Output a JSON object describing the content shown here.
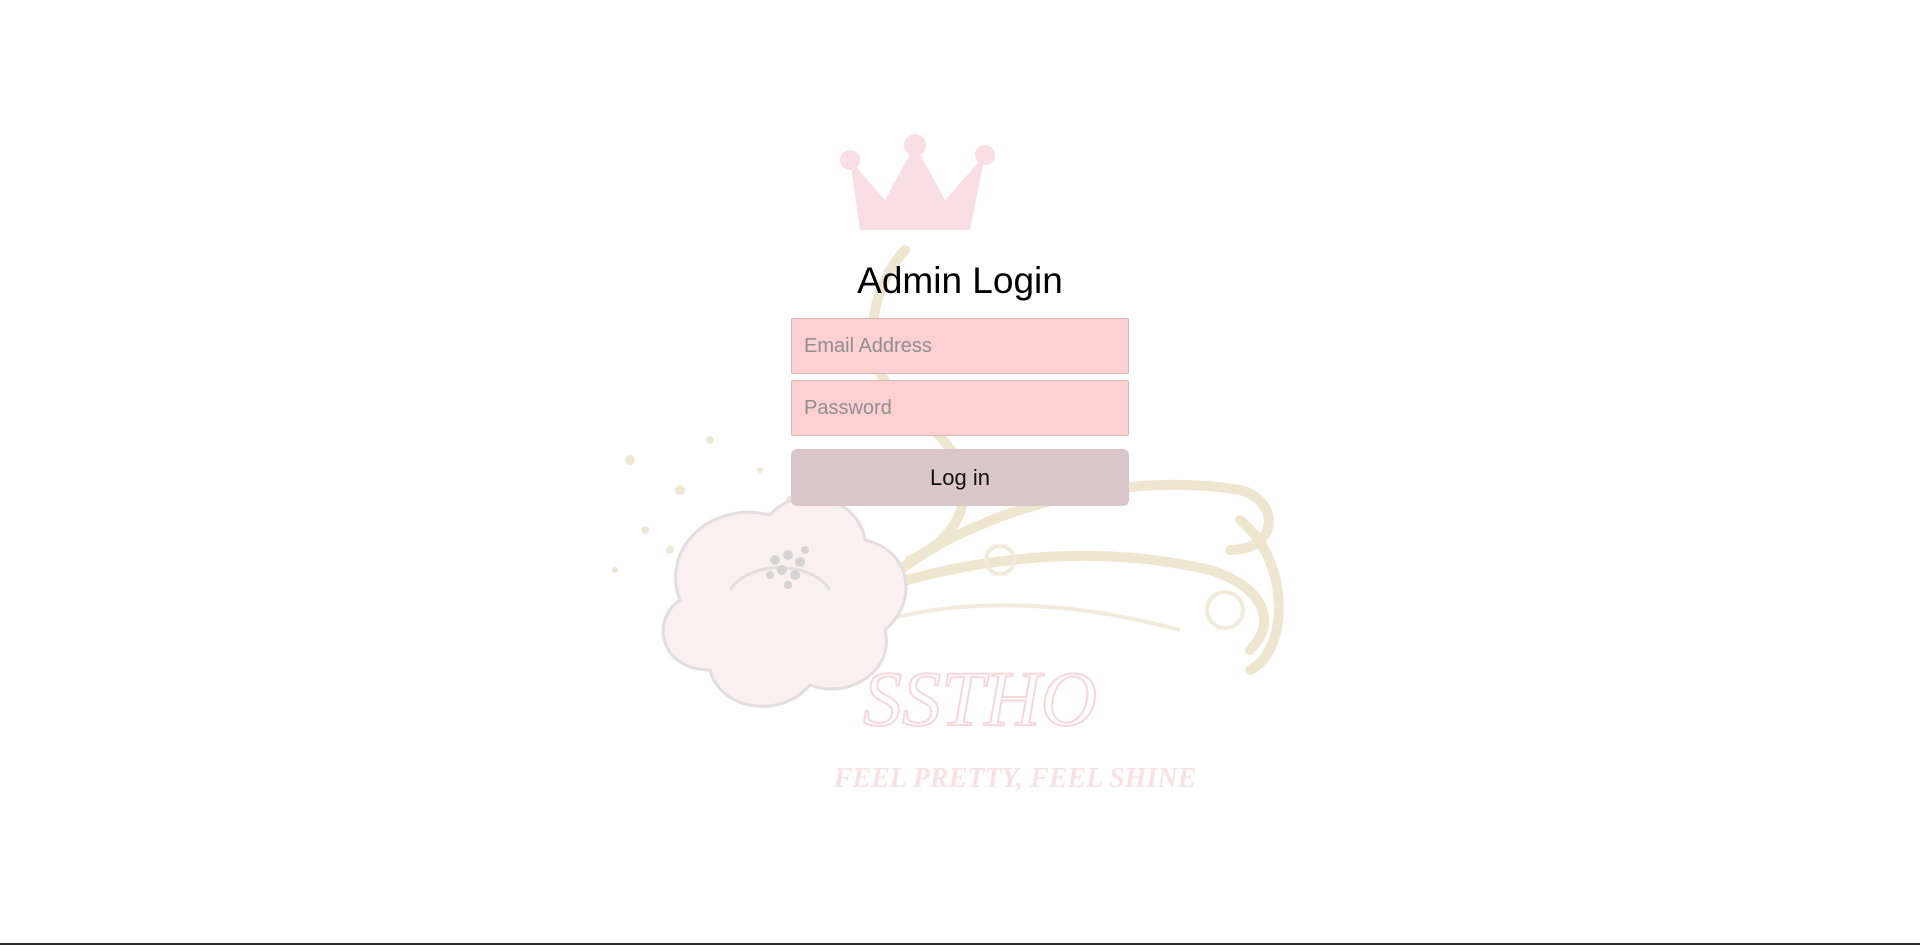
{
  "login": {
    "title": "Admin Login",
    "email_placeholder": "Email Address",
    "email_value": "",
    "password_placeholder": "Password",
    "password_value": "",
    "submit_label": "Log in"
  },
  "watermark": {
    "brand_name": "SSTHO",
    "tagline": "FEEL PRETTY, FEEL SHINE",
    "icons": [
      "crown-icon",
      "flower-icon"
    ]
  },
  "colors": {
    "input_background": "#ffd0d2",
    "button_background": "#dac7cb",
    "watermark_pink": "#f2b7c3",
    "watermark_gold": "#dcc9a0"
  }
}
